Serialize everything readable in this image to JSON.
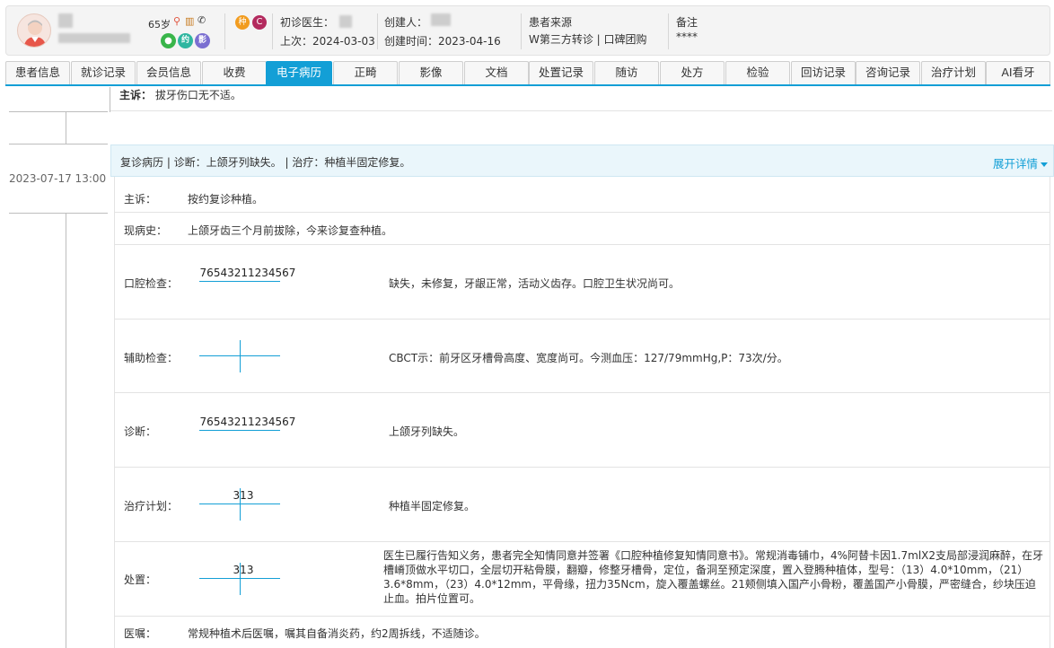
{
  "patient": {
    "age": "65岁",
    "first_doctor_label": "初诊医生：",
    "last_visit": "上次：2024-03-03",
    "creator_label": "创建人：",
    "created_time": "创建时间：2023-04-16",
    "source_label": "患者来源",
    "source_value": "W第三方转诊 | 口碑团购",
    "note_label": "备注",
    "note_value": "****",
    "badge_zhong": "种",
    "badge_c": "C",
    "pill_yue": "约",
    "pill_wang": "影"
  },
  "tabs": [
    {
      "label": "患者信息"
    },
    {
      "label": "就诊记录"
    },
    {
      "label": "会员信息"
    },
    {
      "label": "收费"
    },
    {
      "label": "电子病历"
    },
    {
      "label": "正畸"
    },
    {
      "label": "影像"
    },
    {
      "label": "文档"
    },
    {
      "label": "处置记录"
    },
    {
      "label": "随访"
    },
    {
      "label": "处方"
    },
    {
      "label": "检验"
    },
    {
      "label": "回访记录"
    },
    {
      "label": "咨询记录"
    },
    {
      "label": "治疗计划"
    },
    {
      "label": "AI看牙"
    }
  ],
  "active_tab": "电子病历",
  "top_complaint": {
    "label": "主诉：",
    "value": "拔牙伤口无不适。"
  },
  "timeline": {
    "date": "2023-07-17 13:00"
  },
  "record": {
    "summary": "复诊病历 | 诊断：上颌牙列缺失。 | 治疗：种植半固定修复。",
    "expand_label": "展开详情",
    "complaint": {
      "label": "主诉：",
      "value": "按约复诊种植。"
    },
    "history": {
      "label": "现病史：",
      "value": "上颌牙齿三个月前拔除，今来诊复查种植。"
    },
    "oral_exam": {
      "label": "口腔检查：",
      "teeth": "76543211234567",
      "value": "缺失，未修复，牙龈正常，活动义齿存。口腔卫生状况尚可。"
    },
    "aux_exam": {
      "label": "辅助检查：",
      "value": "CBCT示：前牙区牙槽骨高度、宽度尚可。今测血压：127/79mmHg,P：73次/分。"
    },
    "diagnosis": {
      "label": "诊断：",
      "teeth": "76543211234567",
      "value": "上颌牙列缺失。"
    },
    "plan": {
      "label": "治疗计划：",
      "teeth": "313",
      "value": "种植半固定修复。"
    },
    "dispose": {
      "label": "处置：",
      "teeth": "313",
      "value": "医生已履行告知义务，患者完全知情同意并签署《口腔种植修复知情同意书》。常规消毒铺巾，4%阿替卡因1.7mlX2支局部浸润麻醉，在牙槽嵴顶做水平切口，全层切开粘骨膜，翻瓣，修整牙槽骨，定位，备洞至预定深度，置入登腾种植体，型号：（13）4.0*10mm，（21）3.6*8mm，（23）4.0*12mm，平骨缘，扭力35Ncm，旋入覆盖螺丝。21颊侧填入国产小骨粉，覆盖国产小骨膜，严密缝合，纱块压迫止血。拍片位置可。"
    },
    "advice": {
      "label": "医嘱：",
      "value": "常规种植术后医嘱，嘱其自备消炎药，约2周拆线，不适随诊。"
    }
  },
  "colors": {
    "accent": "#139fd6",
    "header_bg": "#eaf6fb"
  }
}
